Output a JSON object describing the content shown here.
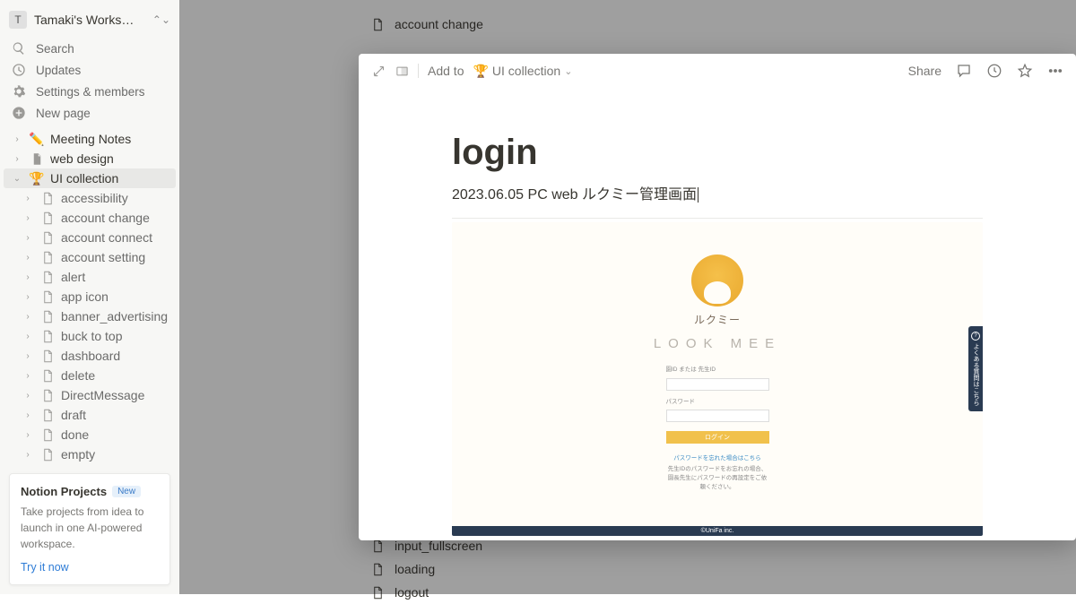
{
  "workspace": {
    "initial": "T",
    "name": "Tamaki's Works…"
  },
  "nav": {
    "search": "Search",
    "updates": "Updates",
    "settings": "Settings & members",
    "newpage": "New page"
  },
  "pages": {
    "meeting_notes": "Meeting Notes",
    "web_design": "web design",
    "ui_collection": "UI collection"
  },
  "children": [
    "accessibility",
    "account change",
    "account connect",
    "account setting",
    "alert",
    "app icon",
    "banner_advertising",
    "buck to top",
    "dashboard",
    "delete",
    "DirectMessage",
    "draft",
    "done",
    "empty"
  ],
  "promo": {
    "title": "Notion Projects",
    "badge": "New",
    "text": "Take projects from idea to launch in one AI-powered workspace.",
    "cta": "Try it now"
  },
  "bg": {
    "crumb": "account change",
    "items": [
      "input_fullscreen",
      "loading",
      "logout"
    ]
  },
  "modal": {
    "addto": "Add to",
    "parent": "UI collection",
    "share": "Share",
    "title": "login",
    "subtitle": "2023.06.05 PC web ルクミー管理画面"
  },
  "login_form": {
    "brand_jp": "ルクミー",
    "brand_en": "LOOK MEE",
    "label_id": "園ID または 先生ID",
    "label_pw": "パスワード",
    "button": "ログイン",
    "forgot": "パスワードを忘れた場合はこちら",
    "note1": "先生IDのパスワードをお忘れの場合、",
    "note2": "園長先生にパスワードの再設定をご依",
    "note3": "頼ください。",
    "faq": "よくある質問はこちら",
    "copyright": "©UniFa inc."
  }
}
